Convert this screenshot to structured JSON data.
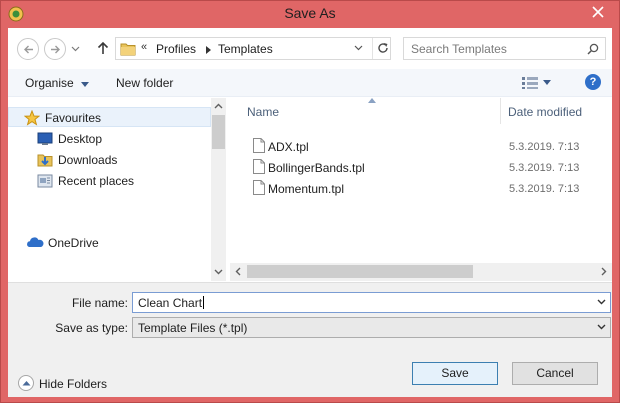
{
  "window": {
    "title": "Save As"
  },
  "address_bar": {
    "overflow": "«",
    "crumbs": [
      "Profiles",
      "Templates"
    ]
  },
  "search": {
    "placeholder": "Search Templates"
  },
  "toolbar": {
    "organise_label": "Organise",
    "new_folder_label": "New folder"
  },
  "nav": {
    "items": [
      {
        "label": "Favourites",
        "icon": "star-icon"
      },
      {
        "label": "Desktop",
        "icon": "desktop-icon"
      },
      {
        "label": "Downloads",
        "icon": "downloads-icon"
      },
      {
        "label": "Recent places",
        "icon": "recent-places-icon"
      },
      {
        "label": "OneDrive",
        "icon": "onedrive-icon"
      }
    ]
  },
  "file_list": {
    "columns": [
      "Name",
      "Date modified"
    ],
    "rows": [
      {
        "name": "ADX.tpl",
        "date": "5.3.2019. 7:13"
      },
      {
        "name": "BollingerBands.tpl",
        "date": "5.3.2019. 7:13"
      },
      {
        "name": "Momentum.tpl",
        "date": "5.3.2019. 7:13"
      }
    ]
  },
  "form": {
    "file_name_label": "File name:",
    "file_name_value": "Clean Chart",
    "save_type_label": "Save as type:",
    "save_type_value": "Template Files (*.tpl)"
  },
  "footer": {
    "hide_folders_label": "Hide Folders",
    "save_label": "Save",
    "cancel_label": "Cancel"
  },
  "colors": {
    "titlebar": "#e06666",
    "accent": "#3c7fb1"
  }
}
